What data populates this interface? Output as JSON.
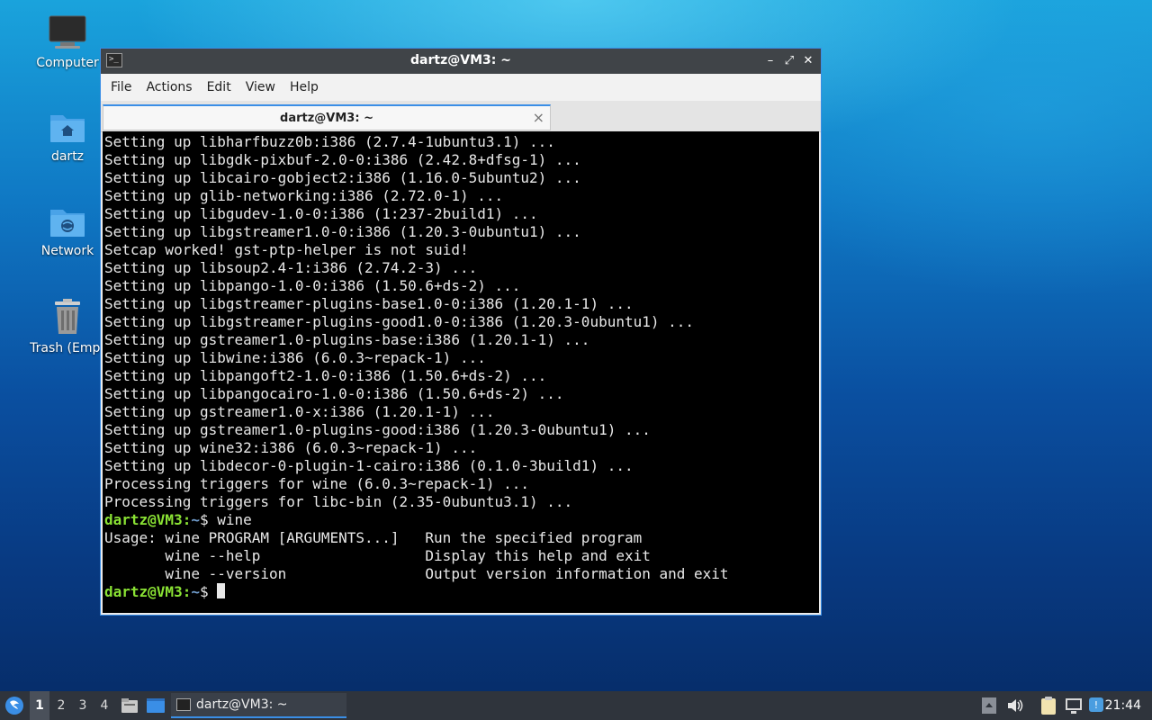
{
  "desktop": {
    "icons": [
      {
        "label": "Computer",
        "icon": "computer-icon"
      },
      {
        "label": "dartz",
        "icon": "home-folder-icon"
      },
      {
        "label": "Network",
        "icon": "network-folder-icon"
      },
      {
        "label": "Trash (Empt",
        "icon": "trash-icon"
      }
    ]
  },
  "window": {
    "title": "dartz@VM3: ~",
    "menu": [
      "File",
      "Actions",
      "Edit",
      "View",
      "Help"
    ],
    "tab": {
      "title": "dartz@VM3: ~",
      "close": "×"
    },
    "controls": {
      "minimize": "–",
      "maximize": "⤢",
      "close": "✕"
    }
  },
  "terminal": {
    "lines": [
      "Setting up libharfbuzz0b:i386 (2.7.4-1ubuntu3.1) ...",
      "Setting up libgdk-pixbuf-2.0-0:i386 (2.42.8+dfsg-1) ...",
      "Setting up libcairo-gobject2:i386 (1.16.0-5ubuntu2) ...",
      "Setting up glib-networking:i386 (2.72.0-1) ...",
      "Setting up libgudev-1.0-0:i386 (1:237-2build1) ...",
      "Setting up libgstreamer1.0-0:i386 (1.20.3-0ubuntu1) ...",
      "Setcap worked! gst-ptp-helper is not suid!",
      "Setting up libsoup2.4-1:i386 (2.74.2-3) ...",
      "Setting up libpango-1.0-0:i386 (1.50.6+ds-2) ...",
      "Setting up libgstreamer-plugins-base1.0-0:i386 (1.20.1-1) ...",
      "Setting up libgstreamer-plugins-good1.0-0:i386 (1.20.3-0ubuntu1) ...",
      "Setting up gstreamer1.0-plugins-base:i386 (1.20.1-1) ...",
      "Setting up libwine:i386 (6.0.3~repack-1) ...",
      "Setting up libpangoft2-1.0-0:i386 (1.50.6+ds-2) ...",
      "Setting up libpangocairo-1.0-0:i386 (1.50.6+ds-2) ...",
      "Setting up gstreamer1.0-x:i386 (1.20.1-1) ...",
      "Setting up gstreamer1.0-plugins-good:i386 (1.20.3-0ubuntu1) ...",
      "Setting up wine32:i386 (6.0.3~repack-1) ...",
      "Setting up libdecor-0-plugin-1-cairo:i386 (0.1.0-3build1) ...",
      "Processing triggers for wine (6.0.3~repack-1) ...",
      "Processing triggers for libc-bin (2.35-0ubuntu3.1) ..."
    ],
    "prompt_user": "dartz@VM3",
    "prompt_sep": ":",
    "prompt_path": "~",
    "prompt_end": "$ ",
    "command": "wine",
    "usage": [
      "Usage: wine PROGRAM [ARGUMENTS...]   Run the specified program",
      "       wine --help                   Display this help and exit",
      "       wine --version                Output version information and exit"
    ]
  },
  "taskbar": {
    "workspaces": [
      "1",
      "2",
      "3",
      "4"
    ],
    "active_workspace": "1",
    "task_label": "dartz@VM3: ~",
    "clock": "21:44",
    "tray_icons": [
      "volume-icon",
      "clipboard-icon",
      "network-icon",
      "update-notifier-icon"
    ]
  },
  "colors": {
    "prompt_user": "#8ae234",
    "prompt_path": "#729fcf",
    "accent": "#3a8ee6",
    "taskbar": "#2f343c"
  }
}
